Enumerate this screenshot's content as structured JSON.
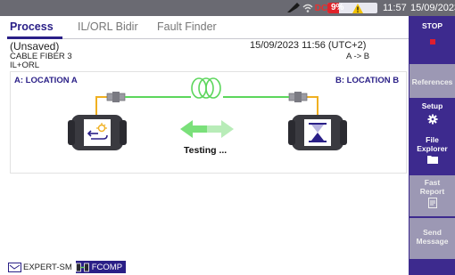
{
  "status_bar": {
    "battery_percent_label": "9%",
    "battery_level": 0.09,
    "dc_label": "DC",
    "time": "11:57",
    "date": "15/09/2023",
    "icons": [
      "probe-icon",
      "wifi-icon",
      "dc-power-icon",
      "warning-icon",
      "battery-icon"
    ]
  },
  "tabs": [
    {
      "label": "Process",
      "active": true
    },
    {
      "label": "IL/ORL Bidir",
      "active": false
    },
    {
      "label": "Fault Finder",
      "active": false
    }
  ],
  "info": {
    "file_name": "(Unsaved)",
    "cable": "CABLE FIBER 3",
    "test_type": "IL+ORL",
    "datetime": "15/09/2023 11:56 (UTC+2)",
    "direction": "A -> B"
  },
  "diagram": {
    "location_a": "A: LOCATION A",
    "location_b": "B: LOCATION B",
    "status_text": "Testing ...",
    "icons": [
      "fiber-spool-icon",
      "connector-icon",
      "source-instrument-icon",
      "hourglass-instrument-icon",
      "bidirectional-arrows-icon"
    ]
  },
  "sidebar": {
    "stop": {
      "label": "STOP"
    },
    "references": {
      "label": "References"
    },
    "setup": {
      "label": "Setup"
    },
    "file_explorer": {
      "line1": "File",
      "line2": "Explorer"
    },
    "fast_report": {
      "line1": "Fast",
      "line2": "Report"
    },
    "send_message": {
      "line1": "Send",
      "line2": "Message"
    }
  },
  "taskbar": [
    {
      "label": "EXPERT-SM",
      "active": false,
      "icon": "expert-sm-icon"
    },
    {
      "label": "FCOMP",
      "active": true,
      "icon": "fcomp-icon"
    }
  ],
  "colors": {
    "accent": "#2a1f87",
    "sidebar": "#3d2a8e",
    "fiber_green": "#5cd65c",
    "connector_yellow": "#f0b020",
    "stop_red": "#e01e2e"
  }
}
